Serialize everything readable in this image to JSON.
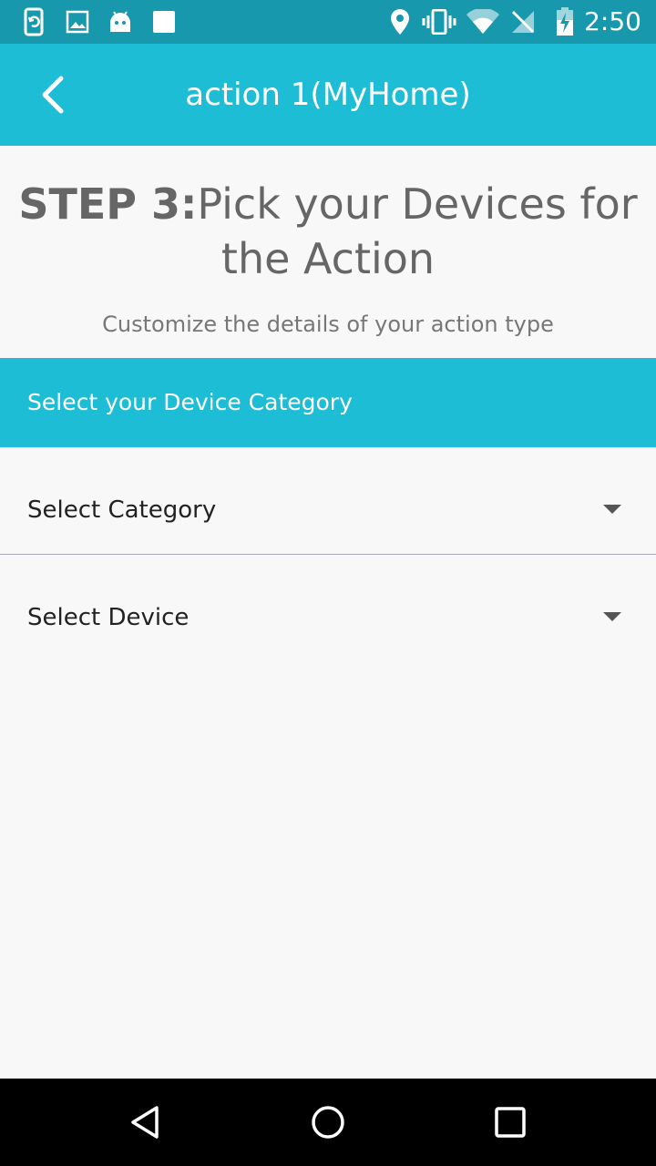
{
  "status_bar": {
    "time": "2:50",
    "icons_left": [
      "sync-phone-icon",
      "image-icon",
      "android-icon",
      "square-icon"
    ],
    "icons_right": [
      "location-icon",
      "vibrate-icon",
      "wifi-icon",
      "no-signal-icon",
      "battery-charging-icon"
    ]
  },
  "app_bar": {
    "title": "action 1(MyHome)",
    "back_icon": "chevron-left-icon",
    "color": "#1dbdd5"
  },
  "step": {
    "prefix": "STEP 3:",
    "title": "Pick your Devices for the Action",
    "subtitle": "Customize the details of your action type"
  },
  "section": {
    "header": "Select your Device Category",
    "color": "#1dbdd5"
  },
  "dropdowns": [
    {
      "label": "Select Category",
      "icon": "caret-down-icon"
    },
    {
      "label": "Select Device",
      "icon": "caret-down-icon"
    }
  ],
  "nav_bar": {
    "buttons": [
      "back-triangle-icon",
      "home-circle-icon",
      "recents-square-icon"
    ]
  }
}
